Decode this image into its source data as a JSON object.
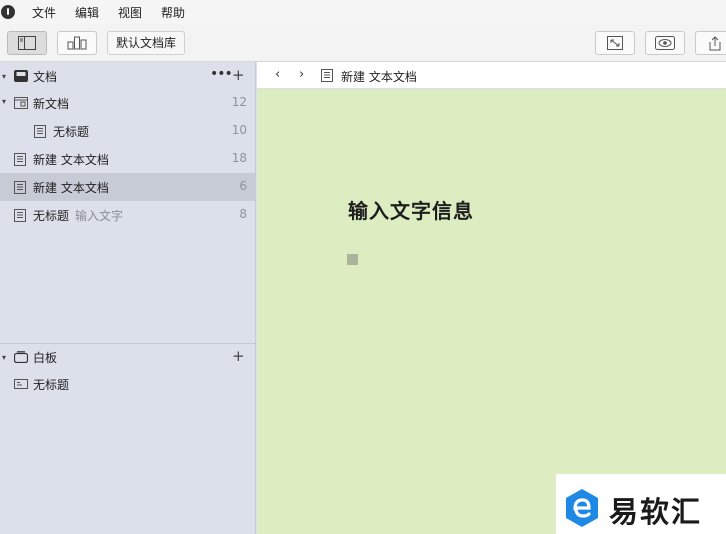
{
  "menu": {
    "items": [
      "文件",
      "编辑",
      "视图",
      "帮助"
    ]
  },
  "toolbar": {
    "library_label": "默认文档库"
  },
  "sidebar": {
    "docs_section": {
      "title": "文档",
      "more_label": "•••",
      "add_label": "+",
      "items": [
        {
          "label": "新文档",
          "sub": "",
          "count": "12",
          "icon": "folder-doc-icon"
        },
        {
          "label": "无标题",
          "sub": "",
          "count": "10",
          "icon": "document-icon"
        },
        {
          "label": "新建 文本文档",
          "sub": "",
          "count": "18",
          "icon": "document-icon"
        },
        {
          "label": "新建 文本文档",
          "sub": "",
          "count": "6",
          "icon": "document-icon"
        },
        {
          "label": "无标题",
          "sub": "输入文字",
          "count": "8",
          "icon": "document-icon"
        }
      ]
    },
    "whiteboard_section": {
      "title": "白板",
      "add_label": "+",
      "items": [
        {
          "label": "无标题",
          "icon": "whiteboard-icon"
        }
      ]
    }
  },
  "editor": {
    "nav_back": "‹",
    "nav_forward": "›",
    "breadcrumb": "新建 文本文档",
    "heading": "输入文字信息"
  },
  "watermark": {
    "text": "易软汇"
  },
  "colors": {
    "sidebar_bg": "#dce0ea",
    "selected_row": "#c7cbd5",
    "editor_bg": "#ddedc2",
    "watermark_blue": "#1e88e5"
  }
}
